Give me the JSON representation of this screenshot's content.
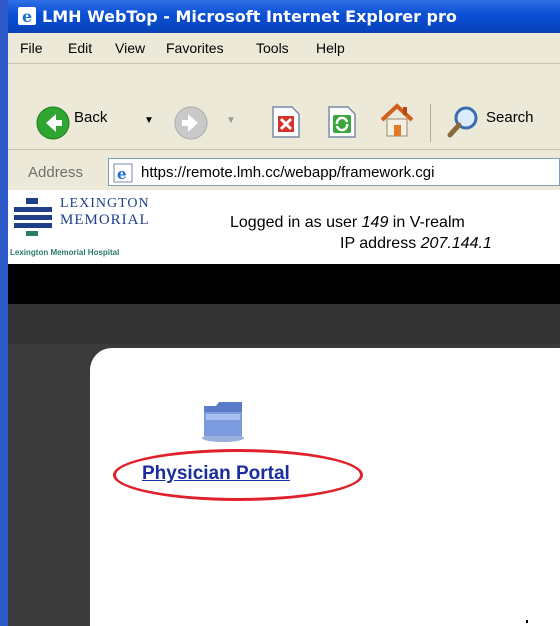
{
  "window": {
    "title": "LMH WebTop - Microsoft Internet Explorer pro"
  },
  "menu": [
    "File",
    "Edit",
    "View",
    "Favorites",
    "Tools",
    "Help"
  ],
  "toolbar": {
    "back_label": "Back",
    "search_label": "Search"
  },
  "address": {
    "label": "Address",
    "url": "https://remote.lmh.cc/webapp/framework.cgi"
  },
  "header": {
    "logo_line1": "LEXINGTON",
    "logo_line2": "MEMORIAL",
    "logo_tagline": "Lexington Memorial Hospital",
    "login_prefix": "Logged in as user ",
    "user": "149",
    "login_mid": " in V-realm",
    "ip_prefix": "IP address ",
    "ip": "207.144.1"
  },
  "content": {
    "portal_link": "Physician Portal"
  },
  "colors": {
    "title_blue": "#0a4fd4",
    "link": "#1a2ea0",
    "annotation": "#e0202a"
  }
}
